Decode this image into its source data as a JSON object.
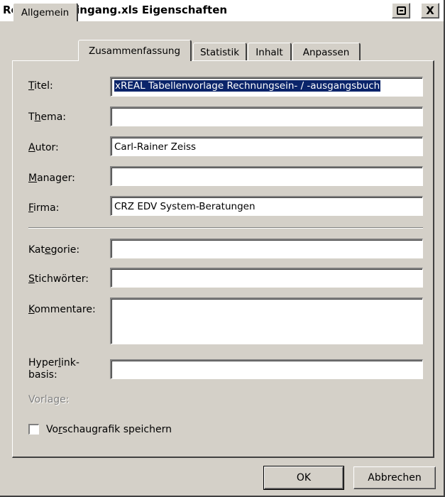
{
  "window": {
    "title": "Rechnungseingang.xls Eigenschaften",
    "help_icon": "help-icon",
    "close_label": "X"
  },
  "tabs": [
    {
      "label": "Allgemein",
      "active": false
    },
    {
      "label": "Zusammenfassung",
      "active": true
    },
    {
      "label": "Statistik",
      "active": false
    },
    {
      "label": "Inhalt",
      "active": false
    },
    {
      "label": "Anpassen",
      "active": false
    }
  ],
  "fields": {
    "titel": {
      "label_u": "T",
      "label_rest": "itel:",
      "value": "xREAL Tabellenvorlage Rechnungsein- / -ausgangsbuch"
    },
    "thema": {
      "label_pre": "T",
      "label_u": "h",
      "label_rest": "ema:",
      "value": ""
    },
    "autor": {
      "label_u": "A",
      "label_rest": "utor:",
      "value": "Carl-Rainer Zeiss"
    },
    "manager": {
      "label_u": "M",
      "label_rest": "anager:",
      "value": ""
    },
    "firma": {
      "label_u": "F",
      "label_rest": "irma:",
      "value": "CRZ EDV System-Beratungen"
    },
    "kategorie": {
      "label_pre": "Kat",
      "label_u": "e",
      "label_rest": "gorie:",
      "value": ""
    },
    "stichwoerter": {
      "label_u": "S",
      "label_rest": "tichwörter:",
      "value": ""
    },
    "kommentare": {
      "label_u": "K",
      "label_rest": "ommentare:",
      "value": ""
    },
    "hyperlink": {
      "label_pre": "Hyper",
      "label_u": "l",
      "label_rest": "ink-",
      "label_line2": "basis:",
      "value": ""
    },
    "vorlage": {
      "label": "Vorlage:"
    }
  },
  "checkbox": {
    "label_pre": "Vo",
    "label_u": "r",
    "label_rest": "schaugrafik speichern",
    "checked": false
  },
  "buttons": {
    "ok": "OK",
    "cancel": "Abbrechen"
  }
}
